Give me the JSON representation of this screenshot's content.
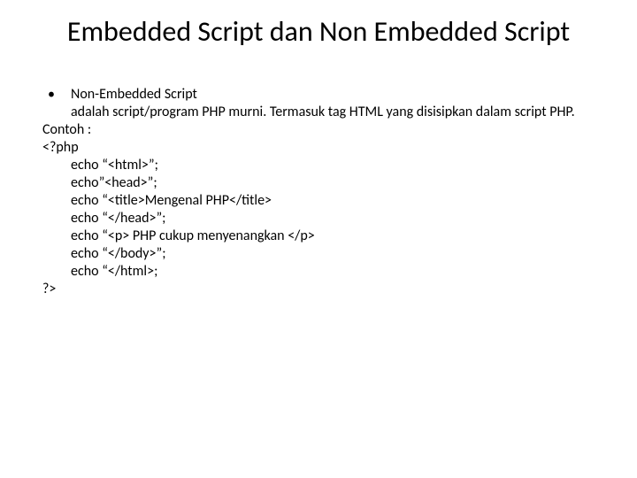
{
  "title": "Embedded Script dan Non Embedded Script",
  "bullet": {
    "marker": "•",
    "heading": "Non-Embedded Script",
    "desc": "adalah script/program PHP murni. Termasuk tag HTML yang disisipkan dalam script PHP."
  },
  "lines": {
    "contoh": "Contoh :",
    "open": "<?php",
    "l1": "echo “<html>”;",
    "l2": "echo”<head>”;",
    "l3": "echo “<title>Mengenal PHP</title>",
    "l4": "echo “</head>”;",
    "l5": "echo “<p> PHP cukup menyenangkan </p>",
    "l6": "echo “</body>”;",
    "l7": "echo “</html>;",
    "close": "?>"
  }
}
